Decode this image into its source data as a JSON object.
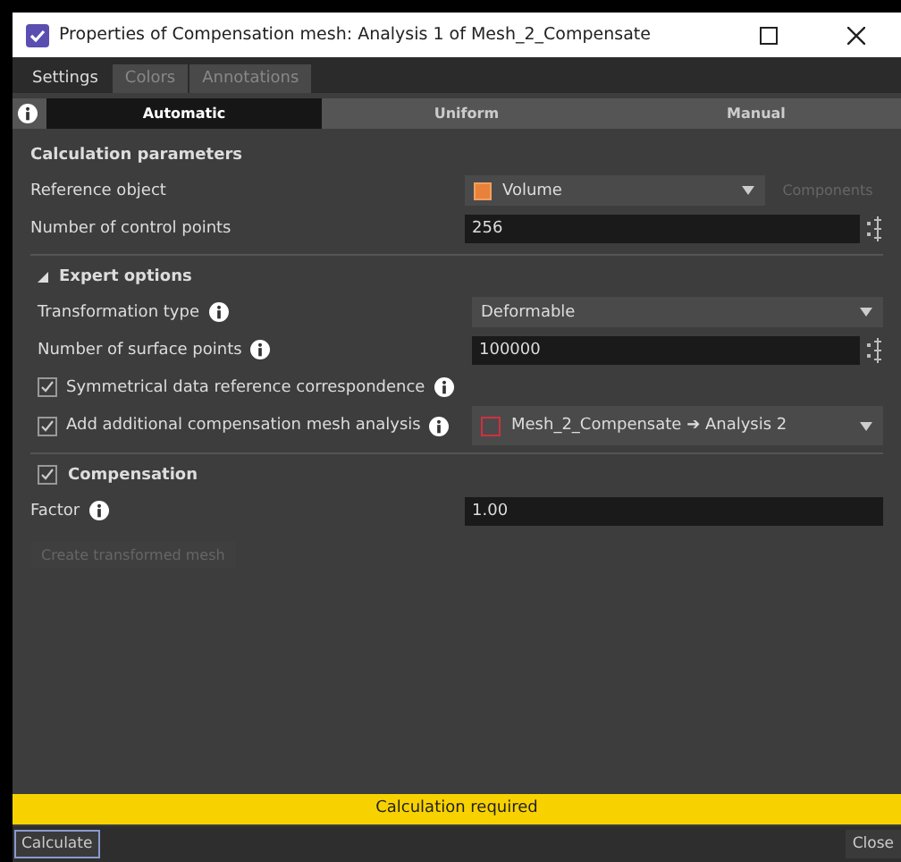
{
  "window": {
    "title": "Properties of Compensation mesh: Analysis 1 of Mesh_2_Compensate"
  },
  "tabs": [
    {
      "label": "Settings",
      "selected": true
    },
    {
      "label": "Colors",
      "selected": false
    },
    {
      "label": "Annotations",
      "selected": false
    }
  ],
  "modes": [
    {
      "label": "Automatic",
      "selected": true
    },
    {
      "label": "Uniform",
      "selected": false
    },
    {
      "label": "Manual",
      "selected": false
    }
  ],
  "calculation": {
    "title": "Calculation parameters",
    "rows": [
      {
        "kind": "select",
        "label": "Reference object",
        "selection": {
          "kind": "volume",
          "text": "Volume"
        },
        "button": {
          "label": "Components",
          "disabled": true
        }
      },
      {
        "kind": "number",
        "label": "Number of control points",
        "value": "256"
      }
    ]
  },
  "expert": {
    "title": "Expert options",
    "expanded": true,
    "rows": [
      {
        "kind": "select",
        "label": "Transformation type",
        "value": "Deformable",
        "info": true
      },
      {
        "kind": "number",
        "label": "Number of surface points",
        "value": "100000",
        "info": true
      },
      {
        "kind": "checkbox",
        "label": "Symmetrical data reference correspondence",
        "checked": true,
        "info": true
      },
      {
        "kind": "checkbox",
        "label": "Add additional compensation mesh analysis",
        "checked": true,
        "info": true,
        "selection": {
          "kind": "mesh",
          "text": "Mesh_2_Compensate ➔ Analysis 2"
        }
      }
    ]
  },
  "compensation": {
    "title": "Compensation",
    "checked": true,
    "rows": [
      {
        "kind": "text",
        "label": "Factor",
        "value": "1.00",
        "info": true
      }
    ],
    "action": {
      "label": "Create transformed mesh",
      "disabled": true
    }
  },
  "status": "Calculation required",
  "buttons": [
    {
      "label": "Calculate",
      "focused": true
    },
    {
      "label": "Close",
      "focused": false
    }
  ]
}
